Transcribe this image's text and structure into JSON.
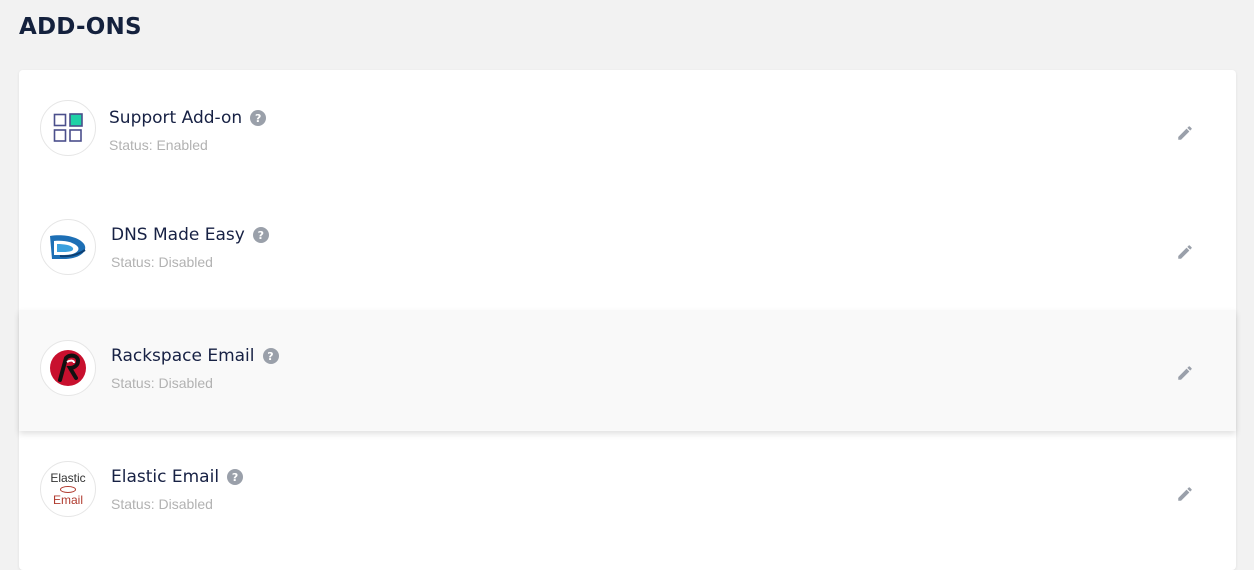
{
  "page": {
    "title": "ADD-ONS"
  },
  "colors": {
    "background": "#f2f2f2",
    "panel": "#ffffff",
    "title_text": "#14213d",
    "status_text": "#b2b2b2",
    "icon_gray": "#9aa0aa",
    "hover_row": "#f9f9f9"
  },
  "addons": [
    {
      "name": "Support Add-on",
      "status": "Status: Enabled",
      "logo_icon": "grid-apps-icon"
    },
    {
      "name": "DNS Made Easy",
      "status": "Status: Disabled",
      "logo_icon": "dns-made-easy-logo"
    },
    {
      "name": "Rackspace Email",
      "status": "Status: Disabled",
      "logo_icon": "rackspace-logo"
    },
    {
      "name": "Elastic Email",
      "status": "Status: Disabled",
      "logo_icon": "elastic-email-logo",
      "logo_text_top": "Elastic",
      "logo_text_bottom": "Email"
    }
  ]
}
